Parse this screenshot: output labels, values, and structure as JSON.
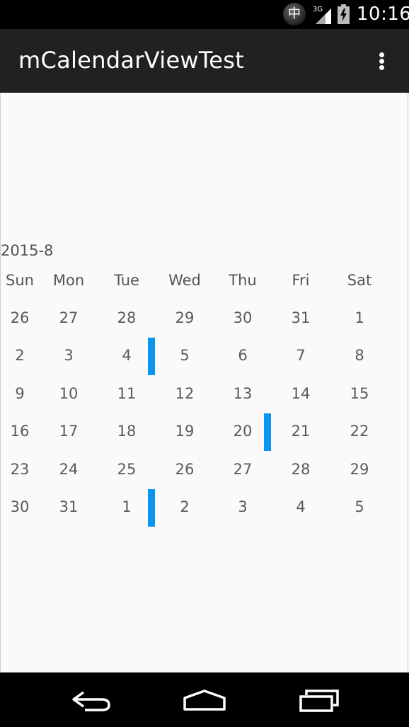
{
  "status_bar": {
    "ime": "中",
    "network": "3G",
    "time": "10:16"
  },
  "app_bar": {
    "title": "mCalendarViewTest",
    "overflow_icon": "overflow-menu-icon"
  },
  "calendar": {
    "month_label": "2015-8",
    "weekdays": [
      "Sun",
      "Mon",
      "Tue",
      "Wed",
      "Thu",
      "Fri",
      "Sat"
    ],
    "weeks": [
      [
        "26",
        "27",
        "28",
        "29",
        "30",
        "31",
        "1"
      ],
      [
        "2",
        "3",
        "4",
        "5",
        "6",
        "7",
        "8"
      ],
      [
        "9",
        "10",
        "11",
        "12",
        "13",
        "14",
        "15"
      ],
      [
        "16",
        "17",
        "18",
        "19",
        "20",
        "21",
        "22"
      ],
      [
        "23",
        "24",
        "25",
        "26",
        "27",
        "28",
        "29"
      ],
      [
        "30",
        "31",
        "1",
        "2",
        "3",
        "4",
        "5"
      ]
    ],
    "marked_days": [
      {
        "week": 1,
        "day": 2
      },
      {
        "week": 3,
        "day": 4
      },
      {
        "week": 5,
        "day": 2
      }
    ],
    "marker_color": "#0a95f0"
  },
  "nav_bar": {
    "back_icon": "back-icon",
    "home_icon": "home-icon",
    "recents_icon": "recents-icon"
  }
}
